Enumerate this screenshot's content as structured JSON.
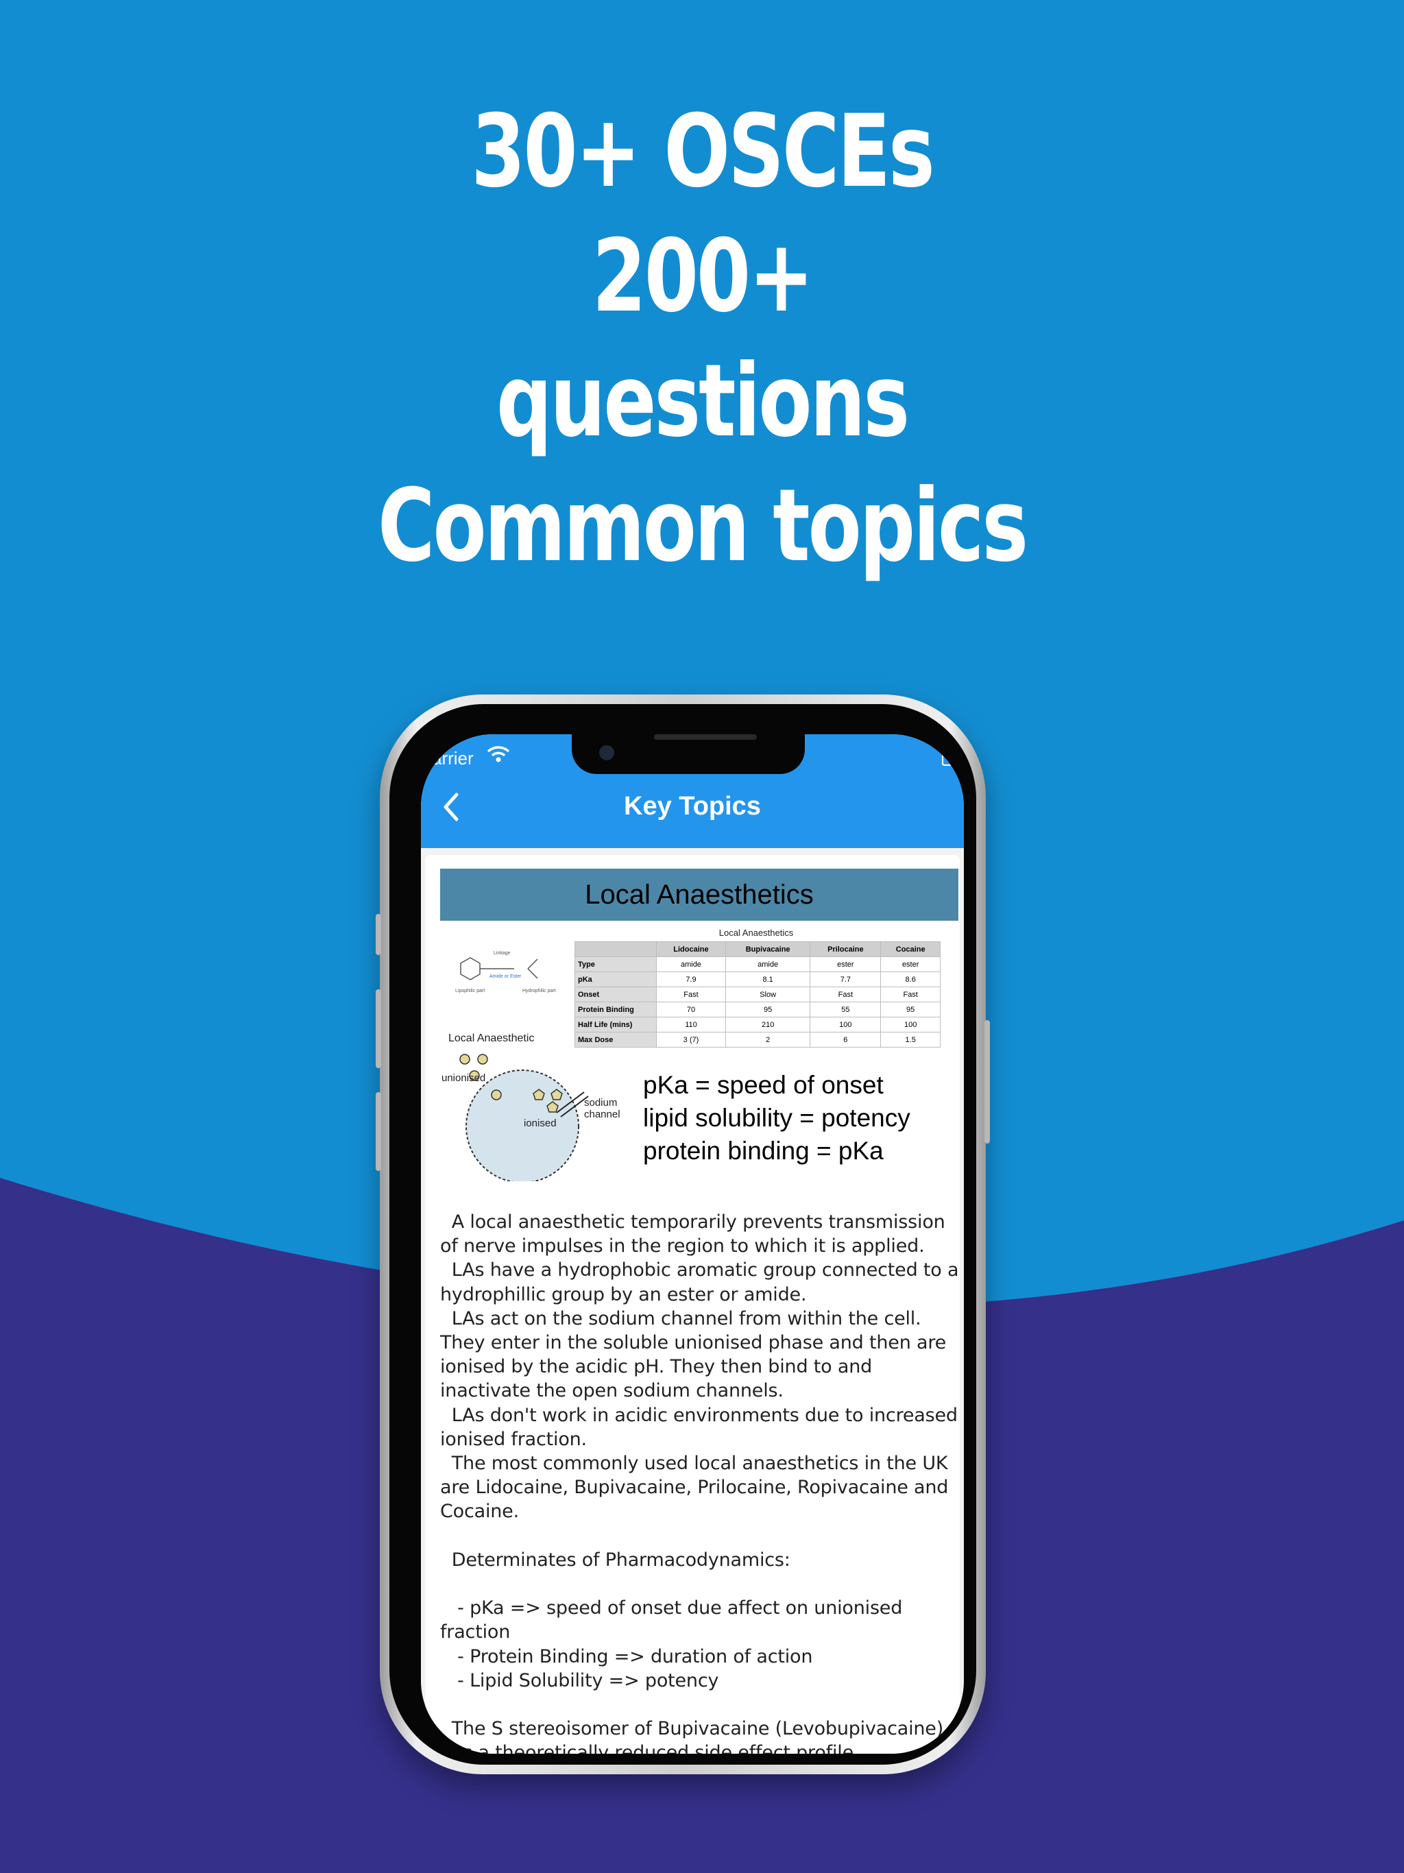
{
  "headline": {
    "line1": "30+ OSCEs",
    "line2": "200+",
    "line3": "questions",
    "line4": "Common topics"
  },
  "colors": {
    "background_top": "#138dd1",
    "background_bottom": "#35308a",
    "navbar": "#2495ed",
    "slide_header": "#4d87a8"
  },
  "status_bar": {
    "carrier": "arrier",
    "wifi_icon": "wifi-icon",
    "battery_icon": "battery-icon"
  },
  "navbar": {
    "back_icon": "chevron-left-icon",
    "title": "Key Topics"
  },
  "slide": {
    "title": "Local Anaesthetics",
    "table_caption": "Local Anaesthetics",
    "table": {
      "headers": [
        "",
        "Lidocaine",
        "Bupivacaine",
        "Prilocaine",
        "Cocaine"
      ],
      "rows": [
        [
          "Type",
          "amide",
          "amide",
          "ester",
          "ester"
        ],
        [
          "pKa",
          "7.9",
          "8.1",
          "7.7",
          "8.6"
        ],
        [
          "Onset",
          "Fast",
          "Slow",
          "Fast",
          "Fast"
        ],
        [
          "Protein Binding",
          "70",
          "95",
          "55",
          "95"
        ],
        [
          "Half Life (mins)",
          "110",
          "210",
          "100",
          "100"
        ],
        [
          "Max Dose",
          "3 (7)",
          "2",
          "6",
          "1.5"
        ]
      ]
    },
    "structure_labels": {
      "linkage": "Linkage",
      "amide_ester": "Amide or Ester",
      "lipophilic": "Lipophilic part",
      "hydrophilic": "Hydrophilic part"
    },
    "diagram_labels": {
      "local_anaesthetic": "Local Anaesthetic",
      "unionised": "unionised",
      "ionised": "ionised",
      "sodium": "sodium",
      "channel": "channel"
    },
    "formula": {
      "line1": "pKa = speed of onset",
      "line2": "lipid solubility = potency",
      "line3": "protein binding = pKa"
    }
  },
  "body_text": "  A local anaesthetic temporarily prevents transmission of nerve impulses in the region to which it is applied.\n  LAs have a hydrophobic aromatic group connected to a hydrophillic group by an ester or amide.\n  LAs act on the sodium channel from within the cell. They enter in the soluble unionised phase and then are ionised by the acidic pH. They then bind to and inactivate the open sodium channels.\n  LAs don't work in acidic environments due to increased ionised fraction.\n  The most commonly used local anaesthetics in the UK are Lidocaine, Bupivacaine, Prilocaine, Ropivacaine and Cocaine.\n\n  Determinates of Pharmacodynamics:\n\n   - pKa => speed of onset due affect on unionised fraction\n   - Protein Binding => duration of action\n   - Lipid Solubility => potency\n\n  The S stereoisomer of Bupivacaine (Levobupivacaine) has a theoretically reduced side effect profile."
}
